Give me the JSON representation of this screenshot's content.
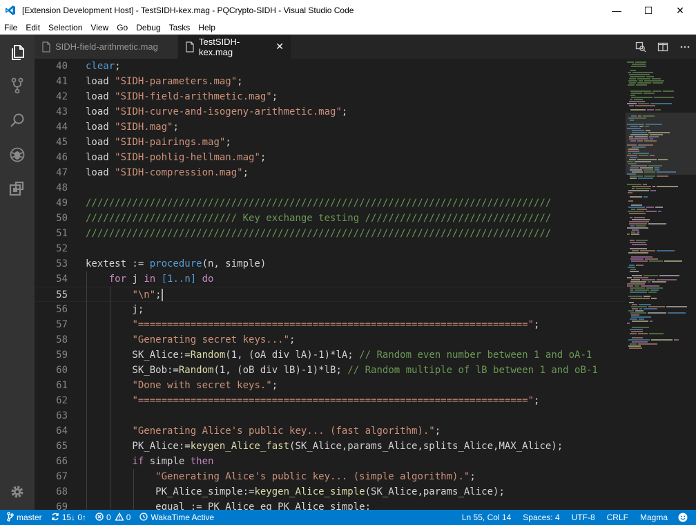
{
  "window": {
    "title": "[Extension Development Host] - TestSIDH-kex.mag - PQCrypto-SIDH - Visual Studio Code",
    "minimize_glyph": "—",
    "maximize_glyph": "☐",
    "close_glyph": "✕"
  },
  "menu": [
    "File",
    "Edit",
    "Selection",
    "View",
    "Go",
    "Debug",
    "Tasks",
    "Help"
  ],
  "tabs": [
    {
      "label": "SIDH-field-arithmetic.mag",
      "active": false
    },
    {
      "label": "TestSIDH-kex.mag",
      "active": true,
      "close_glyph": "✕"
    }
  ],
  "editor": {
    "cursor_line": 55,
    "lines": [
      {
        "n": "40",
        "tokens": [
          [
            "kw",
            "clear"
          ],
          [
            "p",
            ";"
          ]
        ]
      },
      {
        "n": "41",
        "tokens": [
          [
            "p",
            "load "
          ],
          [
            "str",
            "\"SIDH-parameters.mag\""
          ],
          [
            "p",
            ";"
          ]
        ]
      },
      {
        "n": "42",
        "tokens": [
          [
            "p",
            "load "
          ],
          [
            "str",
            "\"SIDH-field-arithmetic.mag\""
          ],
          [
            "p",
            ";"
          ]
        ]
      },
      {
        "n": "43",
        "tokens": [
          [
            "p",
            "load "
          ],
          [
            "str",
            "\"SIDH-curve-and-isogeny-arithmetic.mag\""
          ],
          [
            "p",
            ";"
          ]
        ]
      },
      {
        "n": "44",
        "tokens": [
          [
            "p",
            "load "
          ],
          [
            "str",
            "\"SIDH.mag\""
          ],
          [
            "p",
            ";"
          ]
        ]
      },
      {
        "n": "45",
        "tokens": [
          [
            "p",
            "load "
          ],
          [
            "str",
            "\"SIDH-pairings.mag\""
          ],
          [
            "p",
            ";"
          ]
        ]
      },
      {
        "n": "46",
        "tokens": [
          [
            "p",
            "load "
          ],
          [
            "str",
            "\"SIDH-pohlig-hellman.mag\""
          ],
          [
            "p",
            ";"
          ]
        ]
      },
      {
        "n": "47",
        "tokens": [
          [
            "p",
            "load "
          ],
          [
            "str",
            "\"SIDH-compression.mag\""
          ],
          [
            "p",
            ";"
          ]
        ]
      },
      {
        "n": "48",
        "tokens": []
      },
      {
        "n": "49",
        "tokens": [
          [
            "cm",
            "////////////////////////////////////////////////////////////////////////////////"
          ]
        ]
      },
      {
        "n": "50",
        "tokens": [
          [
            "cm",
            "////////////////////////// Key exchange testing ////////////////////////////////"
          ]
        ]
      },
      {
        "n": "51",
        "tokens": [
          [
            "cm",
            "////////////////////////////////////////////////////////////////////////////////"
          ]
        ]
      },
      {
        "n": "52",
        "tokens": []
      },
      {
        "n": "53",
        "tokens": [
          [
            "p",
            "kextest := "
          ],
          [
            "kw",
            "procedure"
          ],
          [
            "p",
            "(n, simple)"
          ]
        ]
      },
      {
        "n": "54",
        "tokens": [
          [
            "p",
            "    "
          ],
          [
            "kw2",
            "for"
          ],
          [
            "p",
            " j "
          ],
          [
            "kw2",
            "in"
          ],
          [
            "p",
            " "
          ],
          [
            "kw",
            "[1..n]"
          ],
          [
            "p",
            " "
          ],
          [
            "kw2",
            "do"
          ]
        ]
      },
      {
        "n": "55",
        "tokens": [
          [
            "p",
            "        "
          ],
          [
            "str",
            "\"\\n\""
          ],
          [
            "p",
            ";"
          ],
          [
            "caret",
            ""
          ]
        ]
      },
      {
        "n": "56",
        "tokens": [
          [
            "p",
            "        j;"
          ]
        ]
      },
      {
        "n": "57",
        "tokens": [
          [
            "p",
            "        "
          ],
          [
            "str",
            "\"===================================================================\""
          ],
          [
            "p",
            ";"
          ]
        ]
      },
      {
        "n": "58",
        "tokens": [
          [
            "p",
            "        "
          ],
          [
            "str",
            "\"Generating secret keys...\""
          ],
          [
            "p",
            ";"
          ]
        ]
      },
      {
        "n": "59",
        "tokens": [
          [
            "p",
            "        SK_Alice:="
          ],
          [
            "fn",
            "Random"
          ],
          [
            "p",
            "(1, (oA div lA)-1)*lA; "
          ],
          [
            "cm",
            "// Random even number between 1 and oA-1"
          ]
        ]
      },
      {
        "n": "60",
        "tokens": [
          [
            "p",
            "        SK_Bob:="
          ],
          [
            "fn",
            "Random"
          ],
          [
            "p",
            "(1, (oB div lB)-1)*lB; "
          ],
          [
            "cm",
            "// Random multiple of lB between 1 and oB-1"
          ]
        ]
      },
      {
        "n": "61",
        "tokens": [
          [
            "p",
            "        "
          ],
          [
            "str",
            "\"Done with secret keys.\""
          ],
          [
            "p",
            ";"
          ]
        ]
      },
      {
        "n": "62",
        "tokens": [
          [
            "p",
            "        "
          ],
          [
            "str",
            "\"===================================================================\""
          ],
          [
            "p",
            ";"
          ]
        ]
      },
      {
        "n": "63",
        "tokens": []
      },
      {
        "n": "64",
        "tokens": [
          [
            "p",
            "        "
          ],
          [
            "str",
            "\"Generating Alice's public key... (fast algorithm).\""
          ],
          [
            "p",
            ";"
          ]
        ]
      },
      {
        "n": "65",
        "tokens": [
          [
            "p",
            "        PK_Alice:="
          ],
          [
            "fn",
            "keygen_Alice_fast"
          ],
          [
            "p",
            "(SK_Alice,params_Alice,splits_Alice,MAX_Alice);"
          ]
        ]
      },
      {
        "n": "66",
        "tokens": [
          [
            "p",
            "        "
          ],
          [
            "kw2",
            "if"
          ],
          [
            "p",
            " simple "
          ],
          [
            "kw2",
            "then"
          ]
        ]
      },
      {
        "n": "67",
        "tokens": [
          [
            "p",
            "            "
          ],
          [
            "str",
            "\"Generating Alice's public key... (simple algorithm).\""
          ],
          [
            "p",
            ";"
          ]
        ]
      },
      {
        "n": "68",
        "tokens": [
          [
            "p",
            "            PK_Alice_simple:="
          ],
          [
            "fn",
            "keygen_Alice_simple"
          ],
          [
            "p",
            "(SK_Alice,params_Alice);"
          ]
        ]
      },
      {
        "n": "69",
        "tokens": [
          [
            "p",
            "            equal := PK_Alice eq PK_Alice_simple;"
          ]
        ]
      }
    ]
  },
  "statusbar": {
    "branch": "master",
    "sync": "15↓ 0↑",
    "errors": "0",
    "warnings": "0",
    "wakatime": "WakaTime Active",
    "position": "Ln 55, Col 14",
    "spaces": "Spaces: 4",
    "encoding": "UTF-8",
    "eol": "CRLF",
    "language": "Magma"
  },
  "colors": {
    "accent": "#007acc",
    "keyword": "#569cd6",
    "control": "#c586c0",
    "string": "#ce9178",
    "comment": "#6a9955",
    "function": "#dcdcaa"
  },
  "icons": {
    "app": "vscode-logo-icon",
    "explorer": "files-icon",
    "scm": "source-control-icon",
    "search": "search-icon",
    "debug": "debug-icon",
    "extensions": "extensions-icon",
    "settings": "gear-icon",
    "open_changes": "open-changes-icon",
    "split": "split-editor-icon",
    "more": "ellipsis-icon"
  }
}
